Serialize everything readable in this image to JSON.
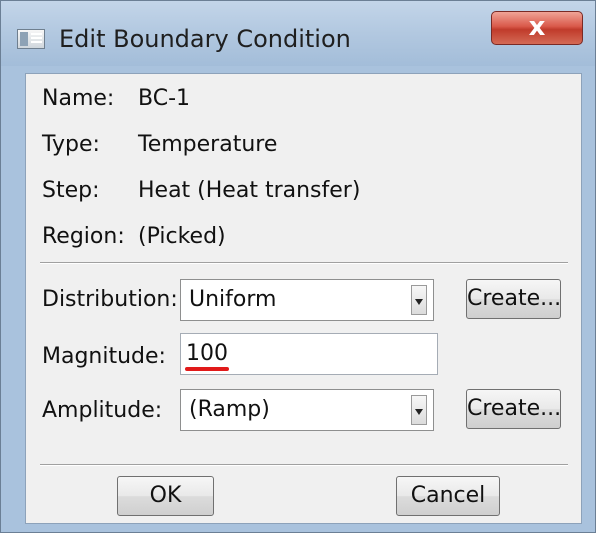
{
  "window": {
    "title": "Edit Boundary Condition",
    "close_label": "x"
  },
  "info": {
    "name_label": "Name:",
    "name_value": "BC-1",
    "type_label": "Type:",
    "type_value": "Temperature",
    "step_label": "Step:",
    "step_value": "Heat (Heat transfer)",
    "region_label": "Region:",
    "region_value": "(Picked)"
  },
  "form": {
    "distribution_label": "Distribution:",
    "distribution_value": "Uniform",
    "distribution_create": "Create...",
    "magnitude_label": "Magnitude:",
    "magnitude_value": "100",
    "amplitude_label": "Amplitude:",
    "amplitude_value": "(Ramp)",
    "amplitude_create": "Create..."
  },
  "buttons": {
    "ok": "OK",
    "cancel": "Cancel"
  },
  "colors": {
    "titlebar": "#b2c8e0",
    "close_button": "#c8483a",
    "annotation_underline": "#e11a1a"
  },
  "icons": [
    "window-app-icon",
    "close-icon",
    "dropdown-arrow-icon"
  ]
}
